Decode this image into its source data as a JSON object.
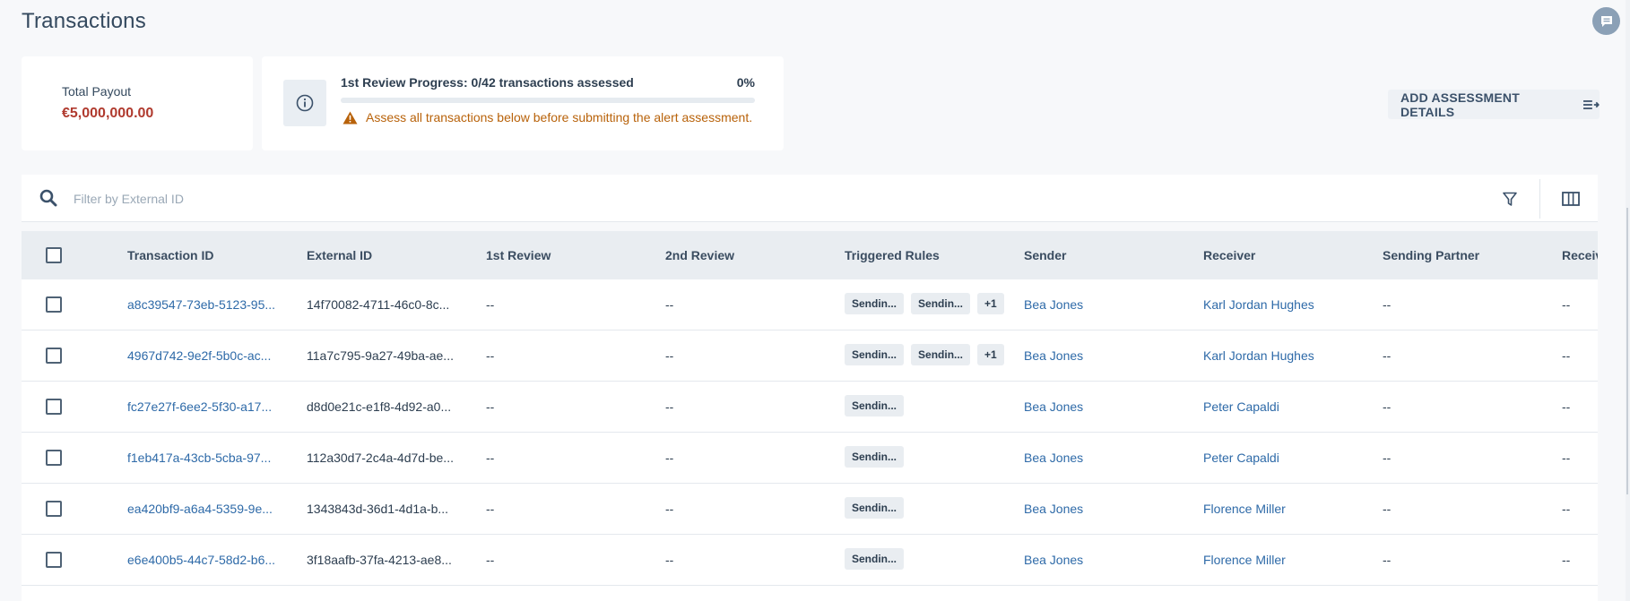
{
  "page": {
    "title": "Transactions"
  },
  "summary": {
    "payout_label": "Total Payout",
    "payout_value": "€5,000,000.00",
    "progress_title": "1st Review Progress: 0/42 transactions assessed",
    "progress_percent_label": "0%",
    "progress_fraction": 0,
    "warning_text": "Assess all transactions below before submitting the alert assessment."
  },
  "actions": {
    "add_assessment_label": "ADD ASSESSMENT DETAILS"
  },
  "search": {
    "placeholder": "Filter by External ID",
    "value": ""
  },
  "table": {
    "headers": [
      "Transaction ID",
      "External ID",
      "1st Review",
      "2nd Review",
      "Triggered Rules",
      "Sender",
      "Receiver",
      "Sending Partner",
      "Receiv"
    ],
    "rows": [
      {
        "transaction_id": "a8c39547-73eb-5123-95...",
        "external_id": "14f70082-4711-46c0-8c...",
        "first_review": "--",
        "second_review": "--",
        "rules": [
          "Sendin...",
          "Sendin...",
          "+1"
        ],
        "sender": "Bea Jones",
        "receiver": "Karl Jordan Hughes",
        "sending_partner": "--",
        "receiving_partner": "--"
      },
      {
        "transaction_id": "4967d742-9e2f-5b0c-ac...",
        "external_id": "11a7c795-9a27-49ba-ae...",
        "first_review": "--",
        "second_review": "--",
        "rules": [
          "Sendin...",
          "Sendin...",
          "+1"
        ],
        "sender": "Bea Jones",
        "receiver": "Karl Jordan Hughes",
        "sending_partner": "--",
        "receiving_partner": "--"
      },
      {
        "transaction_id": "fc27e27f-6ee2-5f30-a17...",
        "external_id": "d8d0e21c-e1f8-4d92-a0...",
        "first_review": "--",
        "second_review": "--",
        "rules": [
          "Sendin..."
        ],
        "sender": "Bea Jones",
        "receiver": "Peter Capaldi",
        "sending_partner": "--",
        "receiving_partner": "--"
      },
      {
        "transaction_id": "f1eb417a-43cb-5cba-97...",
        "external_id": "112a30d7-2c4a-4d7d-be...",
        "first_review": "--",
        "second_review": "--",
        "rules": [
          "Sendin..."
        ],
        "sender": "Bea Jones",
        "receiver": "Peter Capaldi",
        "sending_partner": "--",
        "receiving_partner": "--"
      },
      {
        "transaction_id": "ea420bf9-a6a4-5359-9e...",
        "external_id": "1343843d-36d1-4d1a-b...",
        "first_review": "--",
        "second_review": "--",
        "rules": [
          "Sendin..."
        ],
        "sender": "Bea Jones",
        "receiver": "Florence Miller",
        "sending_partner": "--",
        "receiving_partner": "--"
      },
      {
        "transaction_id": "e6e400b5-44c7-58d2-b6...",
        "external_id": "3f18aafb-37fa-4213-ae8...",
        "first_review": "--",
        "second_review": "--",
        "rules": [
          "Sendin..."
        ],
        "sender": "Bea Jones",
        "receiver": "Florence Miller",
        "sending_partner": "--",
        "receiving_partner": "--"
      }
    ]
  },
  "icons": {
    "chat": "chat-icon",
    "info": "info-icon",
    "warning": "warning-icon",
    "add_assessment": "list-arrow-icon",
    "search": "search-icon",
    "filter": "filter-icon",
    "columns": "columns-icon"
  },
  "colors": {
    "payout": "#b03a2e",
    "warning": "#b8620a",
    "link": "#2e6aa8",
    "header_bg": "#e9edf1"
  }
}
